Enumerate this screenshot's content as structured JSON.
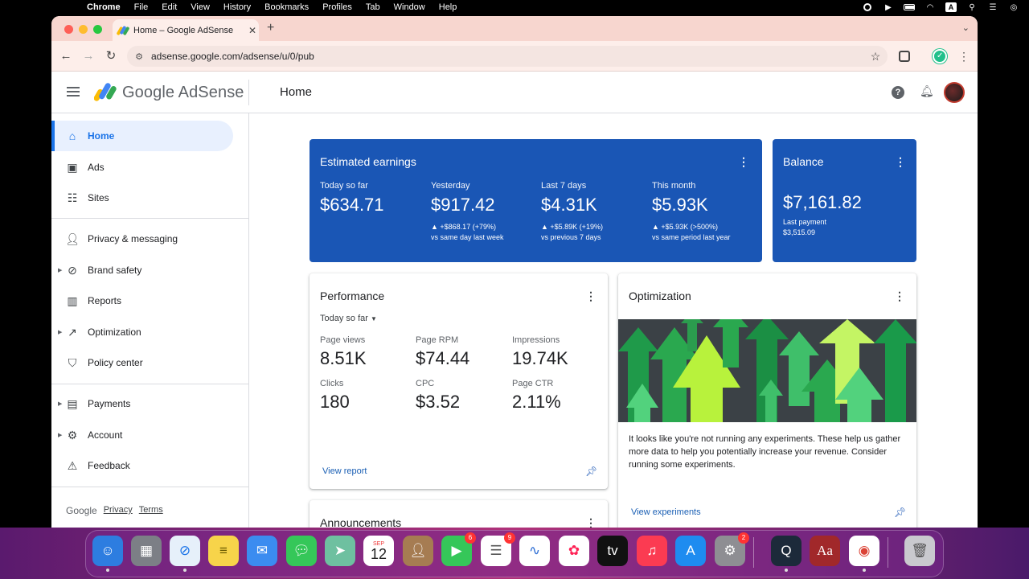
{
  "menubar": {
    "app": "Chrome",
    "items": [
      "File",
      "Edit",
      "View",
      "History",
      "Bookmarks",
      "Profiles",
      "Tab",
      "Window",
      "Help"
    ]
  },
  "browser": {
    "tab_title": "Home – Google AdSense",
    "url": "adsense.google.com/adsense/u/0/pub"
  },
  "header": {
    "product": "Google AdSense",
    "page_title": "Home"
  },
  "sidebar": {
    "items": [
      {
        "label": "Home",
        "icon": "home-icon"
      },
      {
        "label": "Ads",
        "icon": "ads-icon"
      },
      {
        "label": "Sites",
        "icon": "sites-icon"
      },
      {
        "label": "Privacy & messaging",
        "icon": "privacy-icon"
      },
      {
        "label": "Brand safety",
        "icon": "block-icon"
      },
      {
        "label": "Reports",
        "icon": "reports-icon"
      },
      {
        "label": "Optimization",
        "icon": "trending-icon"
      },
      {
        "label": "Policy center",
        "icon": "shield-icon"
      },
      {
        "label": "Payments",
        "icon": "payments-icon"
      },
      {
        "label": "Account",
        "icon": "gear-icon"
      },
      {
        "label": "Feedback",
        "icon": "feedback-icon"
      }
    ],
    "footer": {
      "brand": "Google",
      "privacy": "Privacy",
      "terms": "Terms"
    }
  },
  "earnings": {
    "title": "Estimated earnings",
    "metrics": [
      {
        "label": "Today so far",
        "value": "$634.71",
        "delta": "",
        "compare": ""
      },
      {
        "label": "Yesterday",
        "value": "$917.42",
        "delta": "▲ +$868.17 (+79%)",
        "compare": "vs same day last week"
      },
      {
        "label": "Last 7 days",
        "value": "$4.31K",
        "delta": "▲ +$5.89K (+19%)",
        "compare": "vs previous 7 days"
      },
      {
        "label": "This month",
        "value": "$5.93K",
        "delta": "▲ +$5.93K (>500%)",
        "compare": "vs same period last year"
      }
    ]
  },
  "balance": {
    "title": "Balance",
    "value": "$7,161.82",
    "last_payment_label": "Last payment",
    "last_payment_value": "$3,515.09"
  },
  "performance": {
    "title": "Performance",
    "range": "Today so far",
    "metrics": [
      {
        "label": "Page views",
        "value": "8.51K"
      },
      {
        "label": "Page RPM",
        "value": "$74.44"
      },
      {
        "label": "Impressions",
        "value": "19.74K"
      },
      {
        "label": "Clicks",
        "value": "180"
      },
      {
        "label": "CPC",
        "value": "$3.52"
      },
      {
        "label": "Page CTR",
        "value": "2.11%"
      }
    ],
    "link": "View report"
  },
  "optimization": {
    "title": "Optimization",
    "text": "It looks like you're not running any experiments. These help us gather more data to help you potentially increase your revenue. Consider running some experiments.",
    "link": "View experiments"
  },
  "announcements": {
    "title": "Announcements"
  },
  "dock": {
    "calendar_month": "SEP",
    "calendar_day": "12",
    "badges": {
      "facetime": "6",
      "reminders": "9",
      "settings": "2"
    }
  },
  "colors": {
    "accent": "#1a73e8",
    "card_blue": "#1a56b5",
    "tab_strip": "#f7d6cf"
  }
}
